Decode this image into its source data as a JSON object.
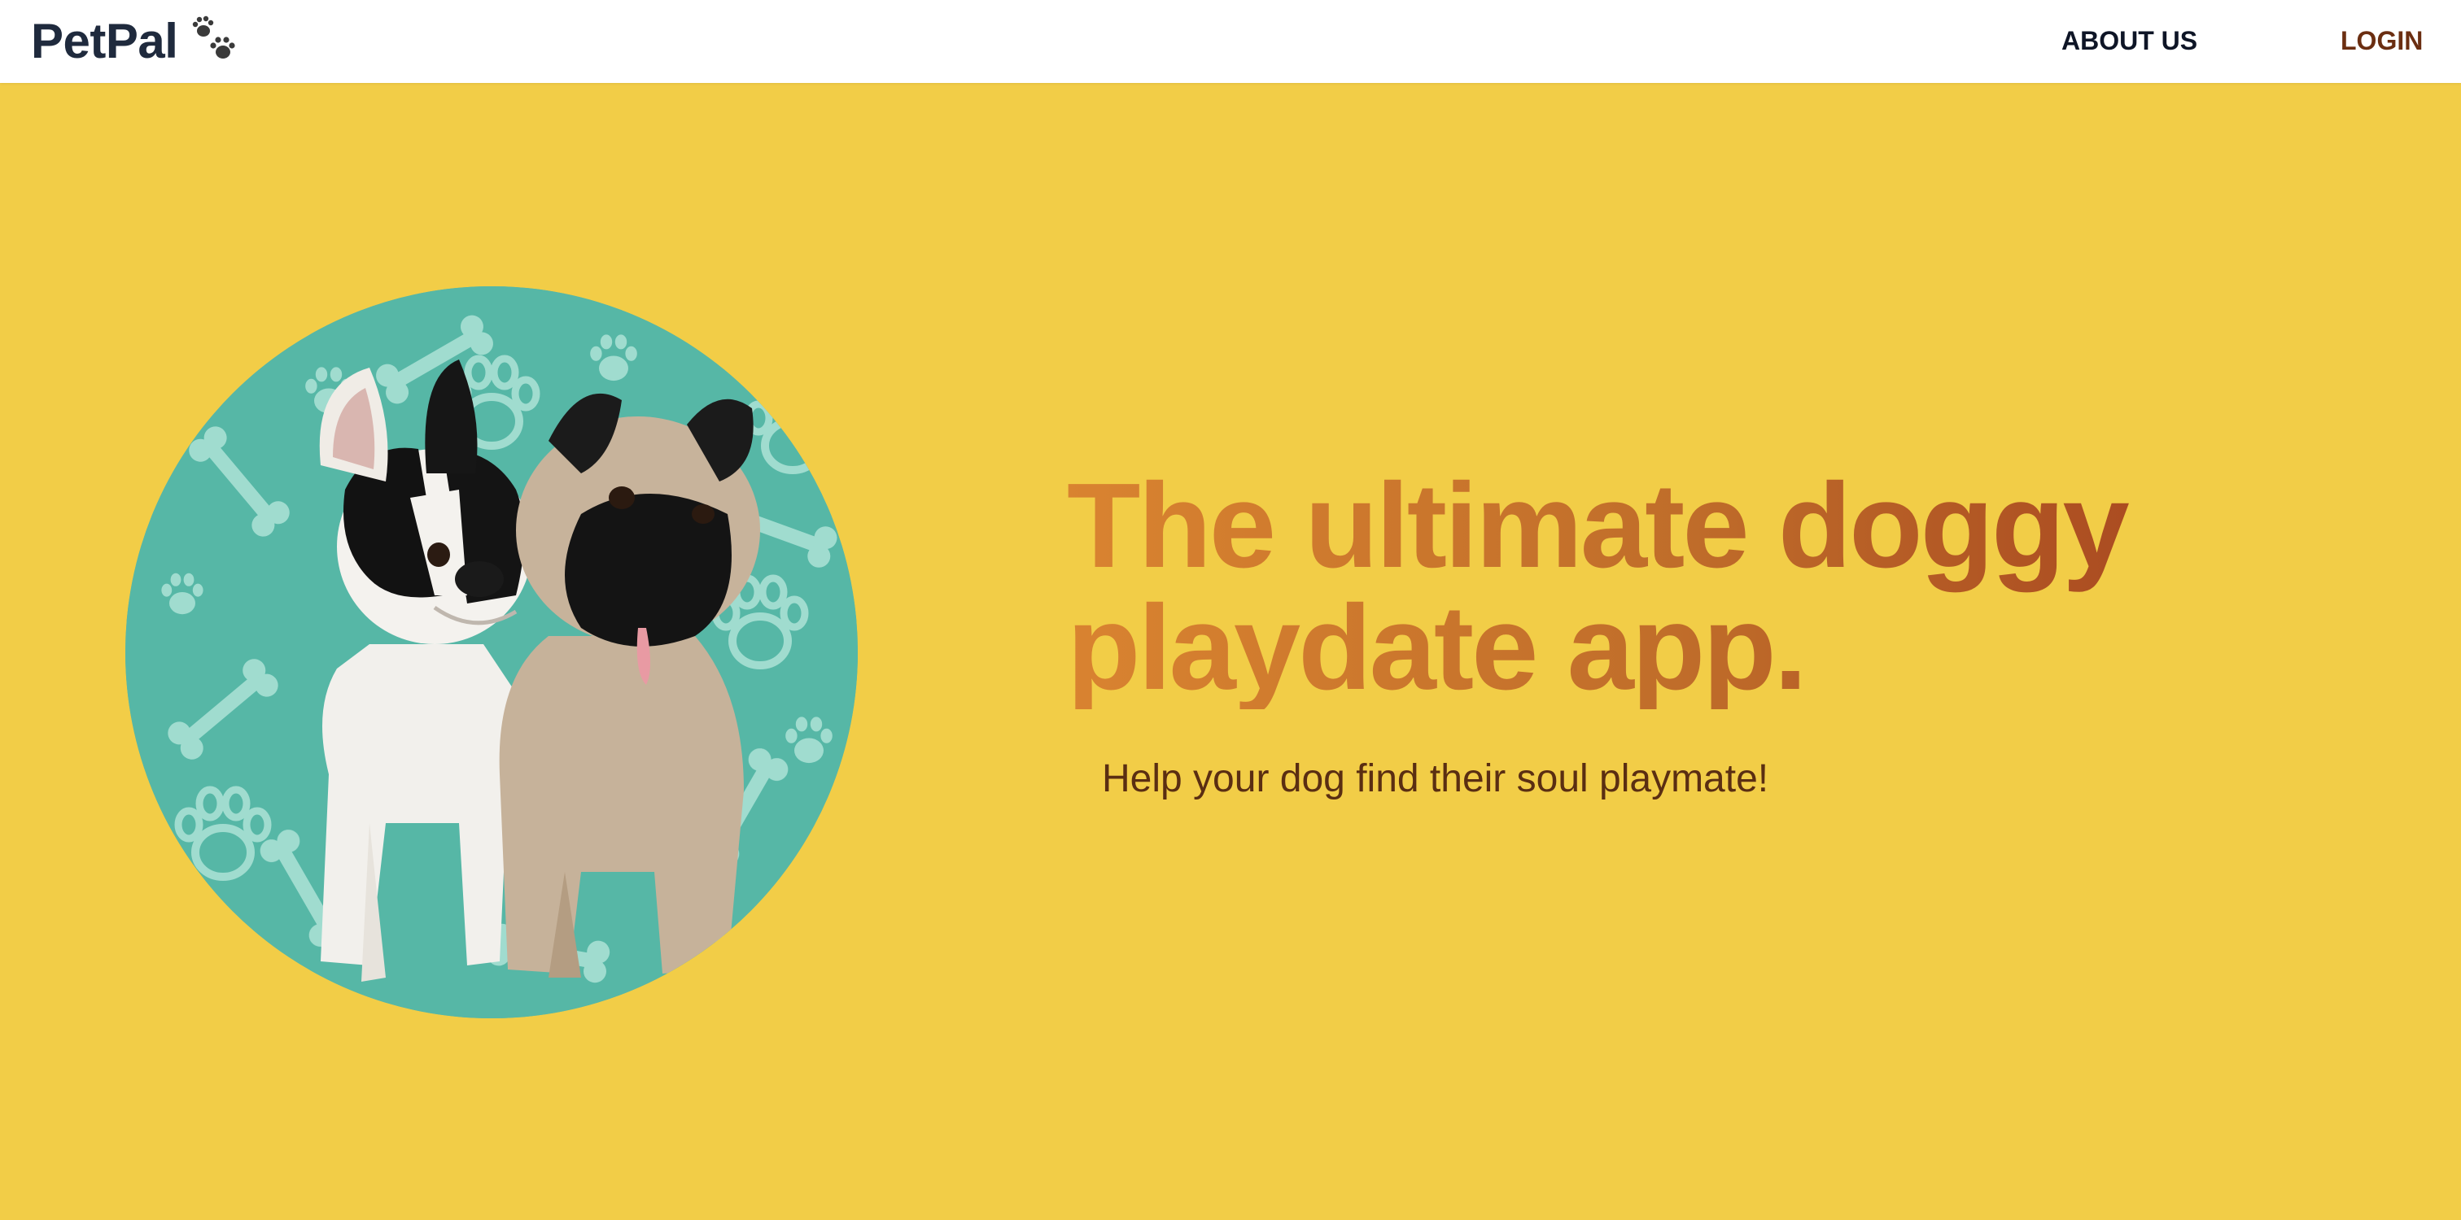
{
  "nav": {
    "brand_name": "PetPal",
    "brand_icon": "paw-icon",
    "about_label": "ABOUT US",
    "login_label": "LOGIN"
  },
  "hero": {
    "headline": "The ultimate doggy playdate app.",
    "tagline": "Help your dog find their soul playmate!",
    "image_description": "Two dogs"
  },
  "colors": {
    "background": "#F2CD47",
    "nav_background": "#FFFFFF",
    "brand_text": "#1F2A3D",
    "about_text": "#0E1526",
    "login_text": "#6B2E11",
    "headline_gradient_start": "#D98330",
    "headline_gradient_end": "#A4411E",
    "tagline_text": "#5A2E12",
    "circle_background": "#56B7A6",
    "pattern_color": "#A9E0D4"
  }
}
